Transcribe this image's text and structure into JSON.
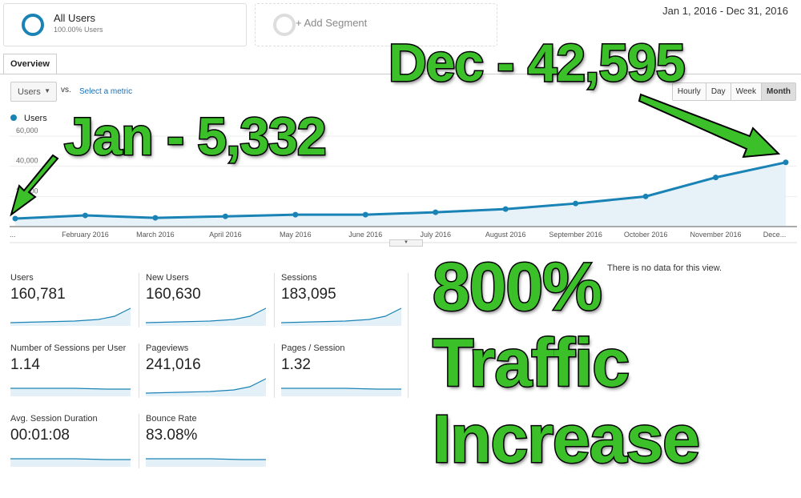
{
  "segments": {
    "all_users": "All Users",
    "all_users_sub": "100.00% Users",
    "add": "+ Add Segment"
  },
  "date_range": "Jan 1, 2016 - Dec 31, 2016",
  "tabs": [
    "Overview"
  ],
  "metric_select": "Users",
  "vs": "vs.",
  "select_metric": "Select a metric",
  "granularity": [
    "Hourly",
    "Day",
    "Week",
    "Month"
  ],
  "granularity_selected": "Month",
  "legend": "Users",
  "colors": {
    "accent": "#1a83b5",
    "annotation": "#3cc02a"
  },
  "chart_data": {
    "type": "line",
    "series": [
      {
        "name": "Users",
        "values": [
          5332,
          7400,
          5800,
          6800,
          7900,
          7900,
          9500,
          11600,
          15300,
          20000,
          32600,
          42595
        ]
      }
    ],
    "categories": [
      "...",
      "February 2016",
      "March 2016",
      "April 2016",
      "May 2016",
      "June 2016",
      "July 2016",
      "August 2016",
      "September 2016",
      "October 2016",
      "November 2016",
      "Dece..."
    ],
    "yticks": [
      "60,000",
      "40,000",
      "20,000"
    ],
    "ylim": [
      0,
      60000
    ],
    "grid": true
  },
  "metrics": [
    {
      "label": "Users",
      "value": "160,781",
      "trend": "up"
    },
    {
      "label": "New Users",
      "value": "160,630",
      "trend": "up"
    },
    {
      "label": "Sessions",
      "value": "183,095",
      "trend": "up"
    },
    {
      "label": "Number of Sessions per User",
      "value": "1.14",
      "trend": "flat"
    },
    {
      "label": "Pageviews",
      "value": "241,016",
      "trend": "up"
    },
    {
      "label": "Pages / Session",
      "value": "1.32",
      "trend": "flat"
    },
    {
      "label": "Avg. Session Duration",
      "value": "00:01:08",
      "trend": "flat"
    },
    {
      "label": "Bounce Rate",
      "value": "83.08%",
      "trend": "flat"
    }
  ],
  "no_data": "There is no data for this view.",
  "annotations": {
    "dec": "Dec - 42,595",
    "jan": "Jan - 5,332",
    "l1": "800%",
    "l2": "Traffic",
    "l3": "Increase"
  }
}
